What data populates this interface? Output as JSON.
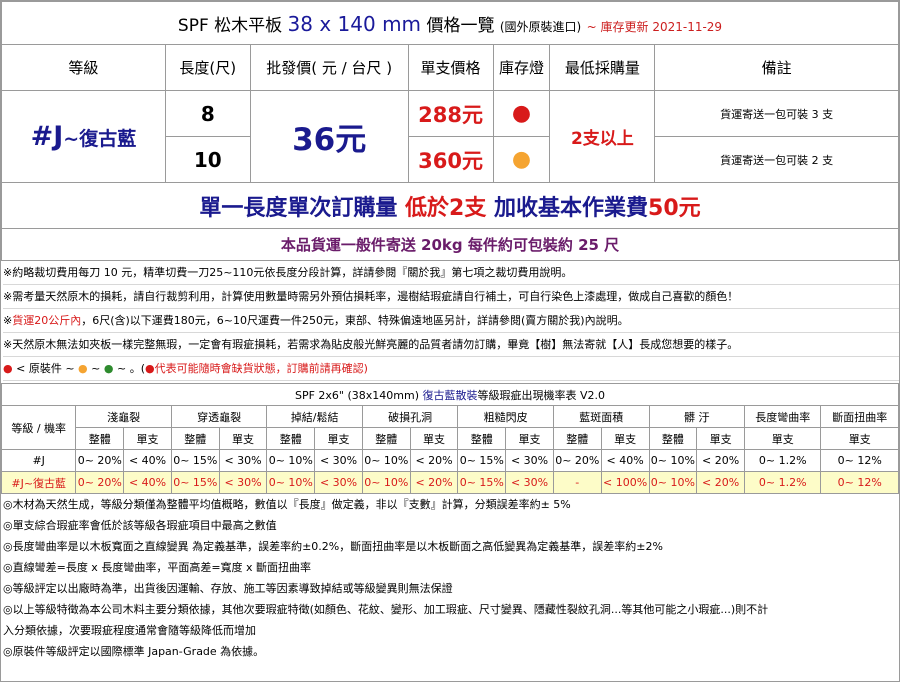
{
  "title": {
    "prefix": "SPF 松木平板 ",
    "size": "38 x 140 mm",
    "suffix": " 價格一覽 ",
    "origin": "(國外原裝進口)",
    "date": "~ 庫存更新 2021-11-29"
  },
  "columns": [
    "等級",
    "長度(尺)",
    "批發價( 元 / 台尺 )",
    "單支價格",
    "庫存燈",
    "最低採購量",
    "備註"
  ],
  "grade": {
    "main": "#J",
    "tail": "~復古藍"
  },
  "price": "36元",
  "min_qty": "2支以上",
  "rows": [
    {
      "length": "8",
      "unit_price": "288元",
      "stock_color": "#d81a1a",
      "note": "貨運寄送一包可裝 3 支"
    },
    {
      "length": "10",
      "unit_price": "360元",
      "stock_color": "#f5a431",
      "note": "貨運寄送一包可裝 2 支"
    }
  ],
  "banner": {
    "a": "單一長度單次訂購量  ",
    "b": "低於2支",
    "c": "  加收基本作業費",
    "d": "50元"
  },
  "shipping": "本品貨運一般件寄送 20kg 每件約可包裝約 25 尺",
  "notes": {
    "n1": "※約略裁切費用每刀 10 元，精準切費一刀25~110元依長度分段計算，詳請參閱『關於我』第七項之裁切費用說明。",
    "n2": "※需考量天然原木的損耗，請自行裁剪利用，計算使用數量時需另外預估損耗率，邊樹結瑕疵請自行補土，可自行染色上漆處理，做成自己喜歡的顏色！",
    "n3a": "※",
    "n3b": "貨運20公斤內",
    "n3c": "，6尺(含)以下運費180元，6~10尺運費一件250元，東部、特殊偏遠地區另計，詳請參閱(賣方關於我)內說明。",
    "n4": "※天然原木無法如夾板一樣完整無瑕，一定會有瑕疵損耗，若需求為貼皮般光鮮亮麗的品質者請勿訂購，畢竟【樹】無法寄就【人】長成您想要的樣子。",
    "n5a": "< 原裝件  ~",
    "n5b": "~",
    "n5c": "~",
    "n5d": "。(",
    "n5e": "代表可能隨時會缺貨狀態，訂購前請再確認)"
  },
  "table2": {
    "title_a": "SPF 2x6\" (38x140mm) ",
    "title_b": "復古藍散裝",
    "title_c": "等級瑕疵出現機率表 V2.0",
    "head": [
      "等級 / 機率",
      "淺龜裂",
      "穿透龜裂",
      "掉結/鬆結",
      "破損孔洞",
      "粗糙閃皮",
      "藍斑面積",
      "髒 汙",
      "長度彎曲率",
      "斷面扭曲率"
    ],
    "sub": [
      "整體",
      "單支",
      "整體",
      "單支",
      "整體",
      "單支",
      "整體",
      "單支",
      "整體",
      "單支",
      "整體",
      "單支",
      "整體",
      "單支",
      "單支",
      "單支"
    ],
    "rowJ": [
      "#J",
      "0~ 20%",
      "< 40%",
      "0~ 15%",
      "< 30%",
      "0~ 10%",
      "< 30%",
      "0~ 10%",
      "< 20%",
      "0~ 15%",
      "< 30%",
      "0~ 20%",
      "< 40%",
      "0~ 10%",
      "< 20%",
      "0~ 1.2%",
      "0~ 12%"
    ],
    "rowB": [
      "#J~復古藍",
      "0~ 20%",
      "< 40%",
      "0~ 15%",
      "< 30%",
      "0~ 10%",
      "< 30%",
      "0~ 10%",
      "< 20%",
      "0~ 15%",
      "< 30%",
      "-",
      "< 100%",
      "0~ 10%",
      "< 20%",
      "0~ 1.2%",
      "0~ 12%"
    ]
  },
  "notes2": [
    "◎木材為天然生成，等級分類僅為整體平均值概略，數值以『長度』做定義，非以『支數』計算，分類誤差率約± 5%",
    "◎單支綜合瑕疵率會低於該等級各瑕疵項目中最高之數值",
    "◎長度彎曲率是以木板寬面之直線變異 為定義基準，誤差率約±0.2%，斷面扭曲率是以木板斷面之高低變異為定義基準，誤差率約±2%",
    "◎直線彎差=長度 x 長度彎曲率，平面高差=寬度 x 斷面扭曲率",
    "◎等級評定以出廠時為準，出貨後因運輸、存放、施工等因素導致掉結或等級變異則無法保證",
    "◎以上等級特徵為本公司木料主要分類依據，其他次要瑕疵特徵(如顏色、花紋、變形、加工瑕疵、尺寸變異、隱藏性裂紋孔洞...等其他可能之小瑕疵...)則不計",
    "入分類依據，次要瑕疵程度通常會隨等級降低而增加",
    "◎原裝件等級評定以國際標準 Japan-Grade 為依據。"
  ]
}
